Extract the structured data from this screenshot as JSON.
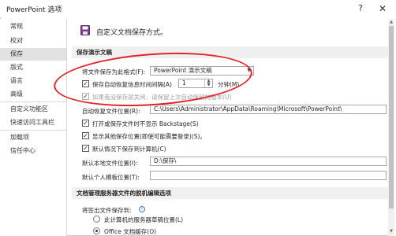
{
  "window": {
    "title": "PowerPoint 选项",
    "help_glyph": "?",
    "close_glyph": "✕"
  },
  "sidebar": {
    "items": [
      {
        "label": "常规",
        "active": false
      },
      {
        "label": "校对",
        "active": false
      },
      {
        "label": "保存",
        "active": true
      },
      {
        "label": "版式",
        "active": false
      },
      {
        "label": "语言",
        "active": false
      },
      {
        "label": "高级",
        "active": false
      },
      {
        "label": "自定义功能区",
        "active": false
      },
      {
        "label": "快速访问工具栏",
        "active": false
      },
      {
        "label": "加载项",
        "active": false
      },
      {
        "label": "信任中心",
        "active": false
      }
    ]
  },
  "main": {
    "header": {
      "text": "自定义文档保存方式。",
      "icon": "save-icon"
    },
    "section_save": {
      "title": "保存演示文稿"
    },
    "format": {
      "label": "将文件保存为此格式(F):",
      "value": "PowerPoint 演示文稿"
    },
    "autorecover": {
      "label": "保存自动恢复信息时间间隔(A)",
      "checked": true,
      "minutes": "1",
      "unit": "分钟(M)"
    },
    "keep_last": {
      "label": "如果我没保存就关闭，请保留上次自动保留的版本(U)",
      "checked": true
    },
    "autorecover_location": {
      "label": "自动恢复文件位置(R):",
      "value": "C:\\Users\\Administrator\\AppData\\Roaming\\Microsoft\\PowerPoint\\"
    },
    "no_backstage": {
      "label": "打开或保存文件时不显示 Backstage(S)",
      "checked": true
    },
    "show_other": {
      "label": "显示其他保存位置(即使可能需要登录)(S)。",
      "checked": true
    },
    "default_computer": {
      "label": "默认情况下保存到计算机(C)",
      "checked": true
    },
    "local_location": {
      "label": "默认本地文件位置(I):",
      "value": "D:\\保存\\"
    },
    "template_location": {
      "label": "默认个人模板位置(T):",
      "value": ""
    },
    "section_offline": {
      "title": "文档管理服务器文件的脱机编辑选项"
    },
    "checkout": {
      "label": "将签出文件保存到:",
      "info_glyph": "i",
      "options": [
        {
          "label": "此计算机的服务器草稿位置(L)",
          "selected": false
        },
        {
          "label": "Office 文档缓存(O)",
          "selected": true
        }
      ]
    }
  }
}
